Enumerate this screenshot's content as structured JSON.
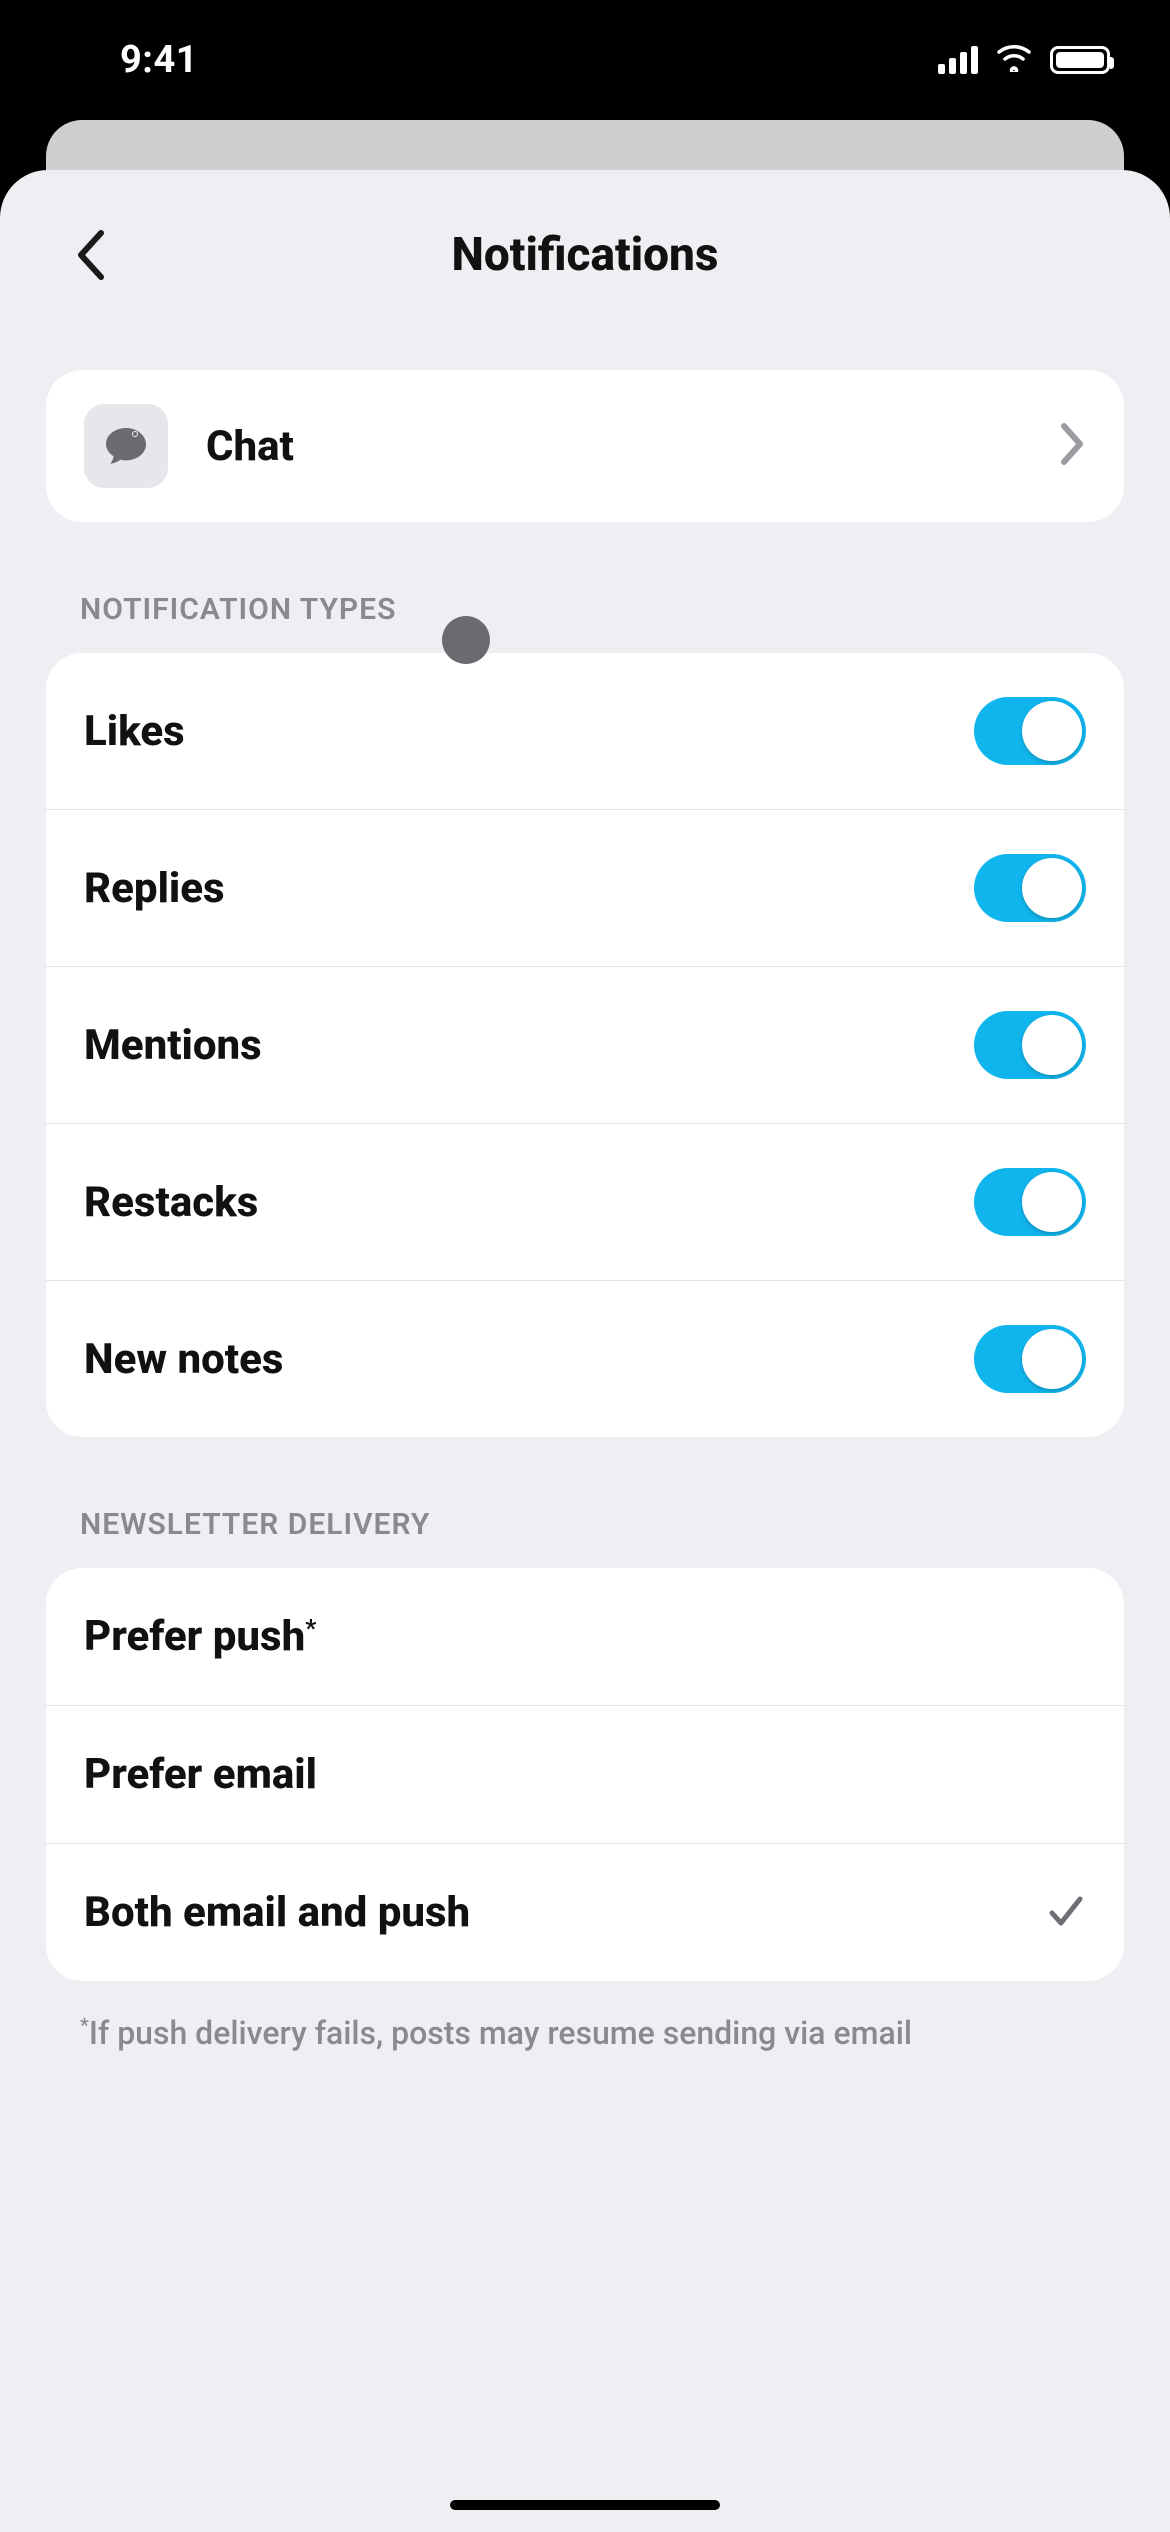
{
  "status": {
    "time": "9:41"
  },
  "header": {
    "title": "Notifications"
  },
  "chat": {
    "label": "Chat"
  },
  "sections": {
    "types_header": "NOTIFICATION TYPES",
    "delivery_header": "NEWSLETTER DELIVERY"
  },
  "types": {
    "likes": {
      "label": "Likes",
      "on": true
    },
    "replies": {
      "label": "Replies",
      "on": true
    },
    "mentions": {
      "label": "Mentions",
      "on": true
    },
    "restacks": {
      "label": "Restacks",
      "on": true
    },
    "new_notes": {
      "label": "New notes",
      "on": true
    }
  },
  "delivery": {
    "prefer_push": {
      "label": "Prefer push",
      "star": "*",
      "selected": false
    },
    "prefer_email": {
      "label": "Prefer email",
      "selected": false
    },
    "both": {
      "label": "Both email and push",
      "selected": true
    }
  },
  "footnote": {
    "star": "*",
    "text": "If push delivery fails, posts may resume sending via email"
  }
}
